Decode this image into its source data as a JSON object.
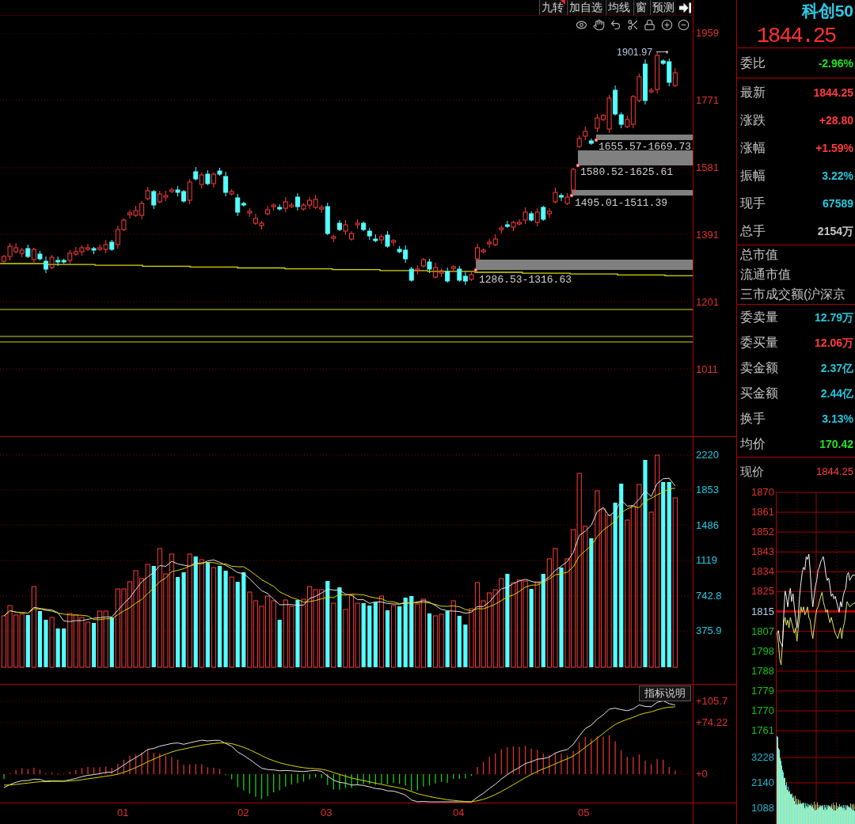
{
  "toolbar": {
    "buttons": [
      {
        "label": "九转",
        "flagged": true
      },
      {
        "label": "加自选",
        "flagged": false
      },
      {
        "label": "均线",
        "flagged": false
      },
      {
        "label": "窗",
        "flagged": false
      },
      {
        "label": "预测",
        "flagged": false
      }
    ]
  },
  "price_chart": {
    "axis_labels": [
      "1959",
      "1771",
      "1581",
      "1391",
      "1201",
      "1011"
    ],
    "high_label": "1901.97",
    "gaps": [
      {
        "label": "1655.57-1669.73"
      },
      {
        "label": "1580.52-1625.61"
      },
      {
        "label": "1495.01-1511.39"
      },
      {
        "label": "1286.53-1316.63"
      }
    ]
  },
  "volume_chart": {
    "axis_labels": [
      "2220",
      "1853",
      "1486",
      "1119",
      "742.8",
      "375.9"
    ]
  },
  "indicator_chart": {
    "button": "指标说明",
    "axis_labels": [
      "+105.7",
      "+74.22",
      "+0"
    ]
  },
  "time_axis": {
    "labels": [
      "01",
      "02",
      "03",
      "04",
      "05"
    ]
  },
  "quote_panel": {
    "name": "科创50",
    "price": "1844.25",
    "sections": [
      {
        "rows": [
          {
            "label": "委比",
            "value": "-2.96%",
            "color": "#22e022"
          }
        ]
      },
      {
        "rows": [
          {
            "label": "最新",
            "value": "1844.25",
            "color": "#ff3c3c"
          },
          {
            "label": "涨跌",
            "value": "+28.80",
            "color": "#ff3c3c"
          },
          {
            "label": "涨幅",
            "value": "+1.59%",
            "color": "#ff3c3c"
          },
          {
            "label": "振幅",
            "value": "3.22%",
            "color": "#22c8dc"
          },
          {
            "label": "现手",
            "value": "67589",
            "color": "#22c8dc"
          },
          {
            "label": "总手",
            "value": "2154万",
            "color": "#c8c8c8"
          }
        ]
      },
      {
        "rows": [
          {
            "label": "总市值"
          },
          {
            "label": "流通市值"
          },
          {
            "label": "三市成交额(沪深京"
          }
        ]
      },
      {
        "rows": [
          {
            "label": "委卖量",
            "value": "12.79万",
            "color": "#22c8dc"
          },
          {
            "label": "委买量",
            "value": "12.06万",
            "color": "#ff3c3c"
          },
          {
            "label": "卖金额",
            "value": "2.37亿",
            "color": "#22c8dc"
          },
          {
            "label": "买金额",
            "value": "2.44亿",
            "color": "#22c8dc"
          },
          {
            "label": "换手",
            "value": "3.13%",
            "color": "#22c8dc"
          },
          {
            "label": "均价",
            "value": "170.42",
            "color": "#22e022"
          }
        ]
      }
    ]
  },
  "intraday_chart": {
    "current": {
      "label": "现价",
      "value": "1844.25",
      "color": "#ff3c3c"
    },
    "price_labels": [
      {
        "text": "1870",
        "color": "#e03030"
      },
      {
        "text": "1861",
        "color": "#e03030"
      },
      {
        "text": "1852",
        "color": "#e03030"
      },
      {
        "text": "1843",
        "color": "#e03030"
      },
      {
        "text": "1834",
        "color": "#e03030"
      },
      {
        "text": "1825",
        "color": "#e03030"
      },
      {
        "text": "1815",
        "color": "#b4d2f0"
      },
      {
        "text": "1807",
        "color": "#18c018"
      },
      {
        "text": "1798",
        "color": "#18c018"
      },
      {
        "text": "1788",
        "color": "#18c018"
      },
      {
        "text": "1779",
        "color": "#18c018"
      },
      {
        "text": "1770",
        "color": "#18c018"
      },
      {
        "text": "1761",
        "color": "#18c018"
      }
    ],
    "volume_labels": [
      "3228",
      "2140",
      "1088"
    ]
  }
}
